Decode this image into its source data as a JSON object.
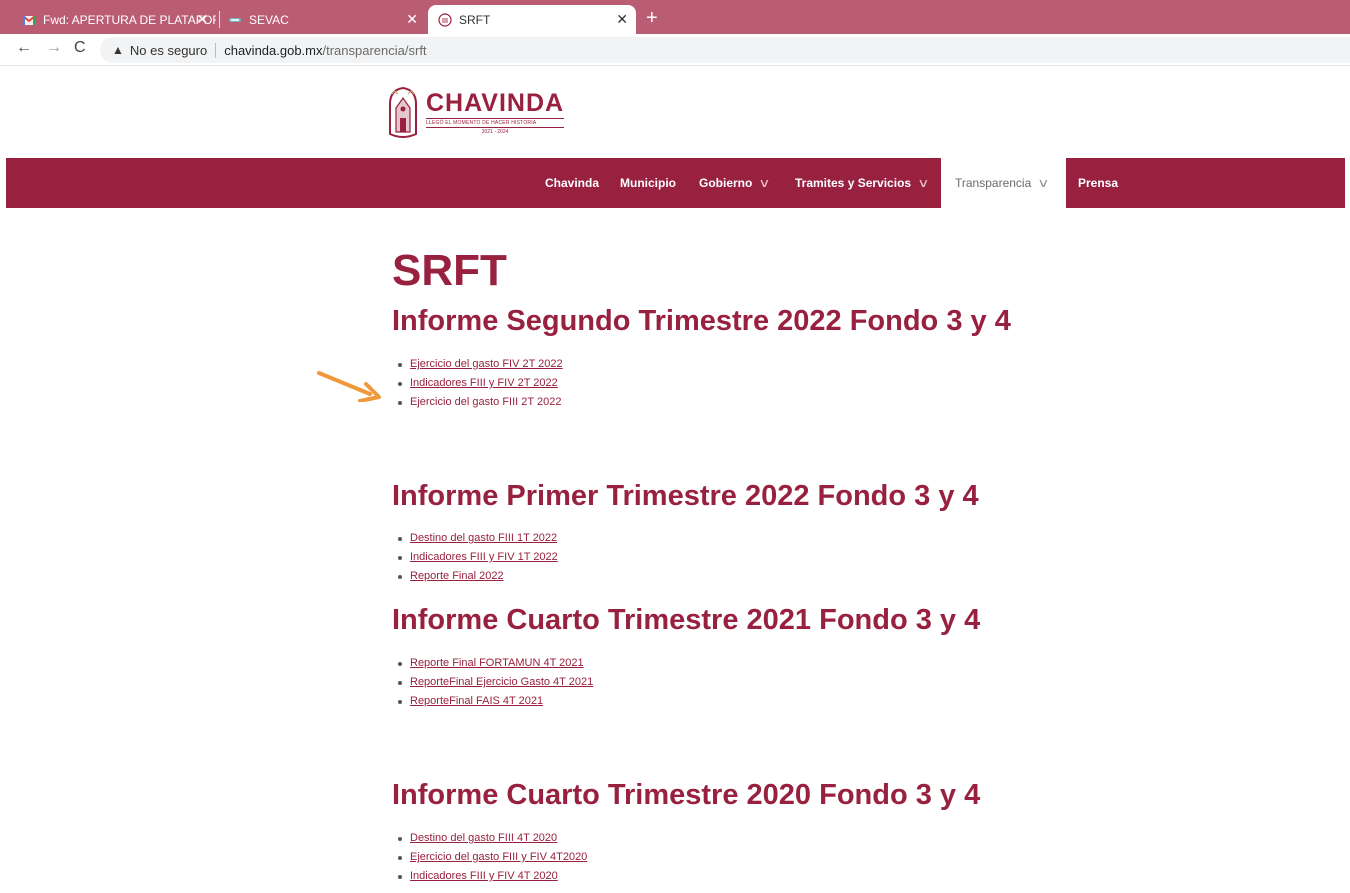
{
  "browser": {
    "tabs": [
      {
        "title": "Fwd: APERTURA DE PLATAFORMA"
      },
      {
        "title": "SEVAC"
      },
      {
        "title": "SRFT"
      }
    ],
    "address": {
      "security_label": "No es seguro",
      "host": "chavinda.gob.mx",
      "path": "/transparencia/srft"
    }
  },
  "site": {
    "logo": {
      "name": "CHAVINDA",
      "tagline": "LLEGÓ EL MOMENTO DE HACER HISTORIA",
      "years": "2021 - 2024"
    },
    "nav": [
      {
        "label": "Chavinda"
      },
      {
        "label": "Municipio"
      },
      {
        "label": "Gobierno"
      },
      {
        "label": "Tramites y Servicios"
      },
      {
        "label": "Transparencia"
      },
      {
        "label": "Prensa"
      }
    ],
    "brand_color": "#98213f"
  },
  "page": {
    "title": "SRFT",
    "sections": [
      {
        "heading": "Informe Segundo Trimestre 2022 Fondo 3 y 4",
        "items": [
          "Ejercicio del gasto FIV 2T 2022",
          "Indicadores FIII y FIV 2T 2022",
          "Ejercicio del gasto FIII 2T 2022"
        ]
      },
      {
        "heading": "Informe Primer Trimestre 2022 Fondo 3 y 4",
        "items": [
          "Destino del gasto FIII 1T 2022",
          "Indicadores FIII y FIV 1T 2022",
          "Reporte Final 2022"
        ]
      },
      {
        "heading": "Informe Cuarto Trimestre 2021 Fondo 3 y 4",
        "items": [
          "Reporte Final FORTAMUN 4T 2021",
          "ReporteFinal Ejercicio Gasto 4T 2021",
          "ReporteFinal FAIS 4T 2021"
        ]
      },
      {
        "heading": "Informe Cuarto Trimestre 2020 Fondo 3 y 4",
        "items": [
          "Destino del gasto FIII 4T 2020",
          "Ejercicio del gasto FIII y FIV 4T2020",
          "Indicadores FIII y FIV 4T 2020"
        ]
      }
    ]
  }
}
